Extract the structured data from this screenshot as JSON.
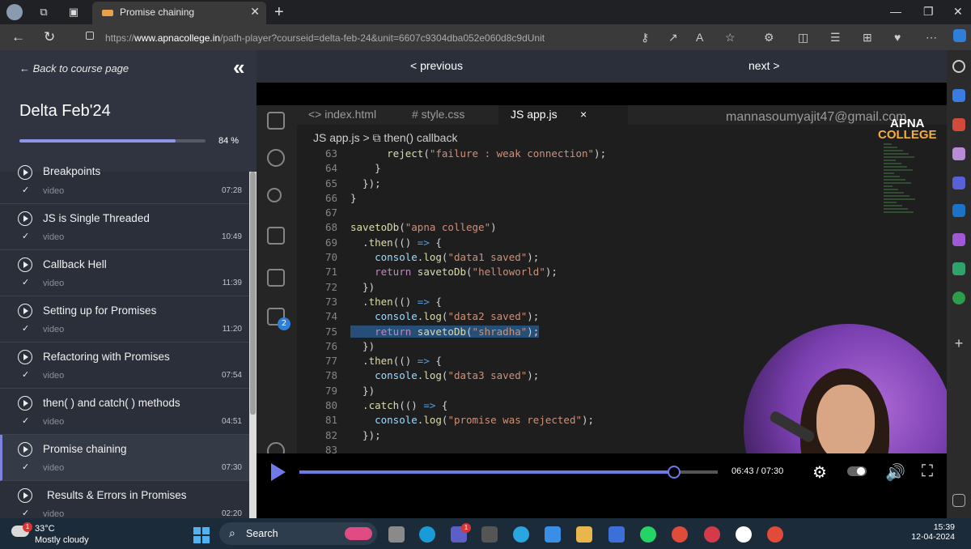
{
  "browser": {
    "tab_title": "Promise chaining",
    "url_prefix": "https://",
    "url_domain": "www.apnacollege.in",
    "url_path": "/path-player?courseid=delta-feb-24&unit=6607c9304dba052e060d8c9dUnit"
  },
  "sidebar": {
    "back_label": "← Back to course page",
    "course_title": "Delta Feb'24",
    "progress_pct": 84,
    "progress_label": "84 %",
    "items": [
      {
        "title": "Breakpoints",
        "kind": "video",
        "duration": "07:28",
        "done": "✓"
      },
      {
        "title": "JS is Single Threaded",
        "kind": "video",
        "duration": "10:49",
        "done": "✓"
      },
      {
        "title": "Callback Hell",
        "kind": "video",
        "duration": "11:39",
        "done": "✓"
      },
      {
        "title": "Setting up for Promises",
        "kind": "video",
        "duration": "11:20",
        "done": "✓"
      },
      {
        "title": "Refactoring with Promises",
        "kind": "video",
        "duration": "07:54",
        "done": "✓"
      },
      {
        "title": "then( ) and catch( ) methods",
        "kind": "video",
        "duration": "04:51",
        "done": "✓"
      },
      {
        "title": "Promise chaining",
        "kind": "video",
        "duration": "07:30",
        "done": "✓"
      },
      {
        "title": "Results & Errors in Promises",
        "kind": "video",
        "duration": "02:20",
        "done": "✓"
      }
    ]
  },
  "player": {
    "prev_label": "< previous",
    "next_label": "next >",
    "time_label": "06:43 / 07:30",
    "progress_fraction": 0.895
  },
  "editor": {
    "tabs": [
      "<> index.html",
      "# style.css",
      "JS  app.js",
      "×"
    ],
    "breadcrumb": "JS  app.js  >  ⧉ then() callback",
    "watermark": "mannasoumyajit47@gmail.com",
    "brand_top": "APNA",
    "brand_bottom": "COLLEGE",
    "badge": "2",
    "lines": [
      {
        "n": "63",
        "code": "      reject(\"failure : weak connection\");"
      },
      {
        "n": "64",
        "code": "    }"
      },
      {
        "n": "65",
        "code": "  });"
      },
      {
        "n": "66",
        "code": "}"
      },
      {
        "n": "67",
        "code": ""
      },
      {
        "n": "68",
        "code": "savetoDb(\"apna college\")"
      },
      {
        "n": "69",
        "code": "  .then(() => {"
      },
      {
        "n": "70",
        "code": "    console.log(\"data1 saved\");"
      },
      {
        "n": "71",
        "code": "    return savetoDb(\"helloworld\");"
      },
      {
        "n": "72",
        "code": "  })"
      },
      {
        "n": "73",
        "code": "  .then(() => {"
      },
      {
        "n": "74",
        "code": "    console.log(\"data2 saved\");"
      },
      {
        "n": "75",
        "code": "    return savetoDb(\"shradha\");"
      },
      {
        "n": "76",
        "code": "  })"
      },
      {
        "n": "77",
        "code": "  .then(() => {"
      },
      {
        "n": "78",
        "code": "    console.log(\"data3 saved\");"
      },
      {
        "n": "79",
        "code": "  })"
      },
      {
        "n": "80",
        "code": "  .catch(() => {"
      },
      {
        "n": "81",
        "code": "    console.log(\"promise was rejected\");"
      },
      {
        "n": "82",
        "code": "  });"
      },
      {
        "n": "83",
        "code": ""
      }
    ]
  },
  "taskbar": {
    "weather_badge": "1",
    "temperature": "33°C",
    "weather_desc": "Mostly cloudy",
    "search_label": "Search",
    "teams_badge": "1",
    "time": "15:39",
    "date": "12-04-2024"
  },
  "colors": {
    "accent": "#6f79e8",
    "sidebar_bg": "#2b2f3a",
    "editor_bg": "#1e1e1e"
  }
}
